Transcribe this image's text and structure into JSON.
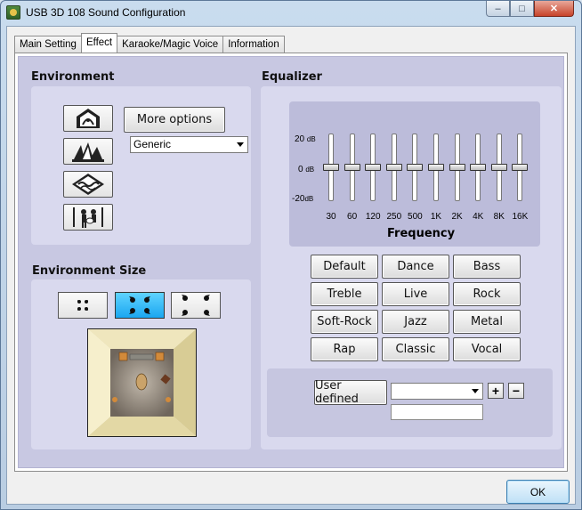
{
  "window": {
    "title": "USB 3D 108 Sound Configuration",
    "controls": {
      "minimize": "–",
      "maximize": "□",
      "close": "✕"
    }
  },
  "tabs": [
    {
      "label": "Main Setting",
      "active": false
    },
    {
      "label": "Effect",
      "active": true
    },
    {
      "label": "Karaoke/Magic Voice",
      "active": false
    },
    {
      "label": "Information",
      "active": false
    }
  ],
  "environment": {
    "heading": "Environment",
    "icons": [
      "room-icon",
      "opera-house-icon",
      "underwater-icon",
      "concert-icon"
    ],
    "more_options_label": "More options",
    "preset_value": "Generic"
  },
  "environment_size": {
    "heading": "Environment Size",
    "sizes": [
      {
        "name": "small",
        "selected": false
      },
      {
        "name": "medium",
        "selected": true
      },
      {
        "name": "large",
        "selected": false
      }
    ]
  },
  "equalizer": {
    "heading": "Equalizer",
    "db_labels": {
      "top": "20",
      "mid": "0",
      "bottom": "-20",
      "unit": "dB"
    },
    "bands": [
      {
        "label": "30",
        "gain_db": 0
      },
      {
        "label": "60",
        "gain_db": 0
      },
      {
        "label": "120",
        "gain_db": 0
      },
      {
        "label": "250",
        "gain_db": 0
      },
      {
        "label": "500",
        "gain_db": 0
      },
      {
        "label": "1K",
        "gain_db": 0
      },
      {
        "label": "2K",
        "gain_db": 0
      },
      {
        "label": "4K",
        "gain_db": 0
      },
      {
        "label": "8K",
        "gain_db": 0
      },
      {
        "label": "16K",
        "gain_db": 0
      }
    ],
    "frequency_label": "Frequency",
    "presets": [
      [
        "Default",
        "Dance",
        "Bass"
      ],
      [
        "Treble",
        "Live",
        "Rock"
      ],
      [
        "Soft-Rock",
        "Jazz",
        "Metal"
      ],
      [
        "Rap",
        "Classic",
        "Vocal"
      ]
    ],
    "user_defined_label": "User defined",
    "user_defined_value": "",
    "name_input_value": "",
    "plus": "+",
    "minus": "−"
  },
  "footer": {
    "ok_label": "OK"
  }
}
